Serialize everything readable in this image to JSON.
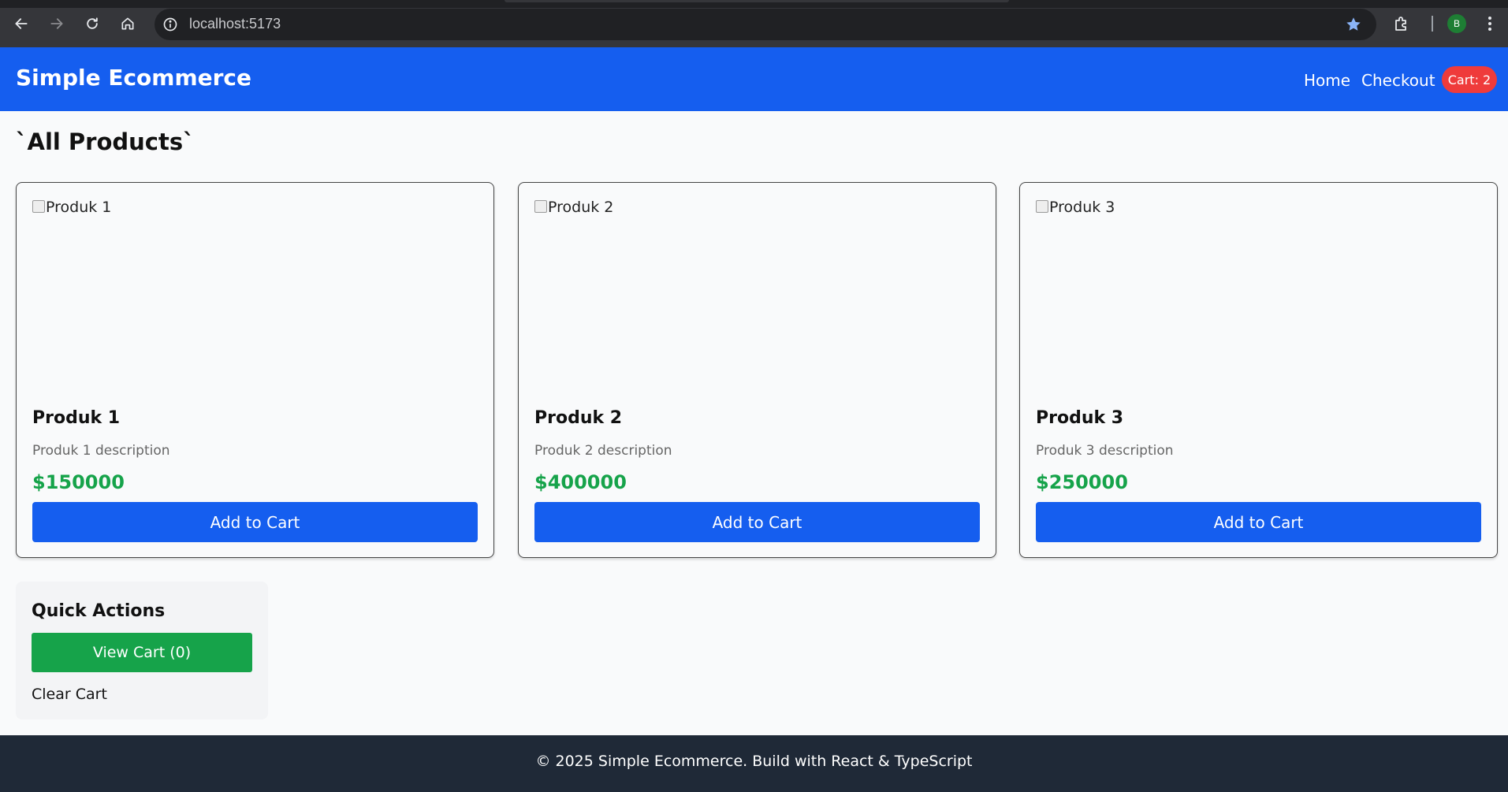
{
  "browser": {
    "url": "localhost:5173",
    "profile_initial": "B",
    "icons": [
      "back-arrow-icon",
      "forward-arrow-icon",
      "reload-icon",
      "home-icon",
      "info-icon",
      "star-icon",
      "extensions-icon",
      "kebab-menu-icon"
    ]
  },
  "header": {
    "brand": "Simple Ecommerce",
    "nav": [
      {
        "label": "Home"
      },
      {
        "label": "Checkout"
      }
    ],
    "cart_badge": "Cart: 2"
  },
  "main": {
    "title": "`All Products`",
    "products": [
      {
        "image_alt": "Produk 1",
        "name": "Produk 1",
        "description": "Produk 1 description",
        "price": "$150000",
        "button": "Add to Cart"
      },
      {
        "image_alt": "Produk 2",
        "name": "Produk 2",
        "description": "Produk 2 description",
        "price": "$400000",
        "button": "Add to Cart"
      },
      {
        "image_alt": "Produk 3",
        "name": "Produk 3",
        "description": "Produk 3 description",
        "price": "$250000",
        "button": "Add to Cart"
      }
    ]
  },
  "quick_actions": {
    "title": "Quick Actions",
    "view_cart": "View Cart (0)",
    "clear_cart": "Clear Cart"
  },
  "footer": {
    "text": "© 2025 Simple Ecommerce. Build with React & TypeScript"
  },
  "colors": {
    "primary": "#155eef",
    "success": "#16a34a",
    "danger": "#ef3b3b",
    "footer_bg": "#1f2937"
  }
}
